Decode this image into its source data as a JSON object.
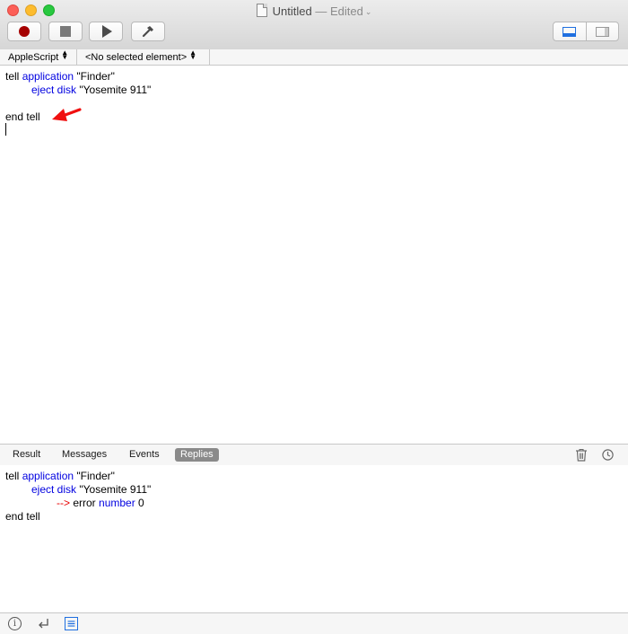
{
  "window": {
    "title": "Untitled",
    "edited": "— Edited"
  },
  "toolbar": {
    "buttons": [
      "record",
      "stop",
      "run",
      "compile"
    ]
  },
  "navigation": {
    "language": "AppleScript",
    "element": "<No selected element>"
  },
  "editor": {
    "lines": [
      {
        "plain1": "tell ",
        "kw": "application",
        "plain2": " \"Finder\""
      },
      {
        "kw": "eject disk",
        "plain2": " \"Yosemite 911\""
      },
      {
        "plain1": ""
      },
      {
        "plain1": "end tell"
      }
    ]
  },
  "result_tabs": {
    "result": "Result",
    "messages": "Messages",
    "events": "Events",
    "replies": "Replies",
    "selected": "Replies"
  },
  "replies": {
    "line1": {
      "plain1": "tell ",
      "kw": "application",
      "plain2": " \"Finder\""
    },
    "line2": {
      "kw": "eject disk",
      "plain2": " \"Yosemite 911\""
    },
    "line3": {
      "arrow": "-->",
      "plain1": " error ",
      "kw": "number",
      "plain2": " 0"
    },
    "line4": {
      "plain1": "end tell"
    }
  },
  "colors": {
    "keyword": "#0000e0",
    "error_arrow": "#e80000",
    "annotation_arrow": "#f01010",
    "record": "#a50000",
    "accent": "#1f6fe0"
  },
  "icons": [
    "document-icon",
    "record-icon",
    "stop-icon",
    "play-icon",
    "hammer-icon",
    "bottom-panel-icon",
    "side-panel-icon",
    "trash-icon",
    "clock-icon",
    "info-icon",
    "return-icon",
    "list-icon",
    "annotation-arrow"
  ]
}
